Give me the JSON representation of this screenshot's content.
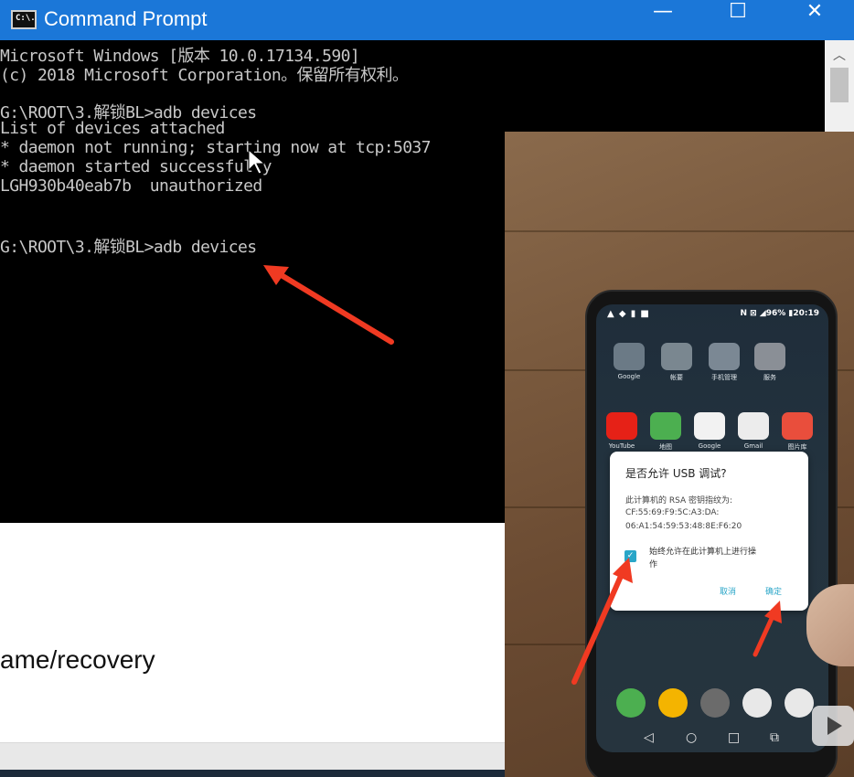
{
  "window": {
    "title": "Command Prompt",
    "icon_label": "C:\\.",
    "min_glyph": "—",
    "max_glyph": "☐",
    "close_glyph": "✕"
  },
  "console": {
    "lines": [
      "Microsoft Windows [版本 10.0.17134.590]",
      "(c) 2018 Microsoft Corporation。保留所有权利。",
      "",
      "G:\\ROOT\\3.解锁BL>adb devices",
      "List of devices attached",
      "* daemon not running; starting now at tcp:5037",
      "* daemon started successfully",
      "LGH930b40eab7b  unauthorized",
      "",
      "",
      "G:\\ROOT\\3.解锁BL>adb devices"
    ]
  },
  "scrollbar": {
    "up_glyph": "︿"
  },
  "document": {
    "visible_text": "ame/recovery"
  },
  "phone": {
    "status_left": "▲ ◆ ▮ ■",
    "status_right": "N ⊠ ◢96% ▮20:19",
    "apps_row1": [
      {
        "label": "Google",
        "color": "#6b7a86"
      },
      {
        "label": "帐要",
        "color": "#7a8790"
      },
      {
        "label": "手机管理",
        "color": "#7b8894"
      },
      {
        "label": "服务",
        "color": "#8a8f96"
      }
    ],
    "apps_row2": [
      {
        "label": "YouTube",
        "color": "#e62117"
      },
      {
        "label": "地图",
        "color": "#4caf50"
      },
      {
        "label": "Google",
        "color": "#f2f2f2"
      },
      {
        "label": "Gmail",
        "color": "#ececec"
      },
      {
        "label": "图片库",
        "color": "#e94e3c"
      }
    ],
    "dock": [
      {
        "name": "phone",
        "color": "#4caf50"
      },
      {
        "name": "messages",
        "color": "#f4b400"
      },
      {
        "name": "camera",
        "color": "#6b6b6b"
      },
      {
        "name": "play-store",
        "color": "#e8e8e8"
      },
      {
        "name": "chrome",
        "color": "#e8e8e8"
      }
    ],
    "nav": {
      "back": "◁",
      "home": "○",
      "recent": "□",
      "switch": "⧉"
    },
    "dialog": {
      "title": "是否允许 USB 调试?",
      "body_lines": [
        "此计算机的 RSA 密钥指纹为:",
        "CF:55:69:F9:5C:A3:DA:",
        "06:A1:54:59:53:48:8E:F6:20"
      ],
      "check_glyph": "✓",
      "checkbox_label_lines": [
        "始终允许在此计算机上进行操",
        "作"
      ],
      "cancel": "取消",
      "ok": "确定"
    }
  },
  "colors": {
    "titlebar": "#1b77d8",
    "arrow": "#f03a22",
    "console_text": "#c8c8c8",
    "dialog_accent": "#2aa6c8"
  }
}
